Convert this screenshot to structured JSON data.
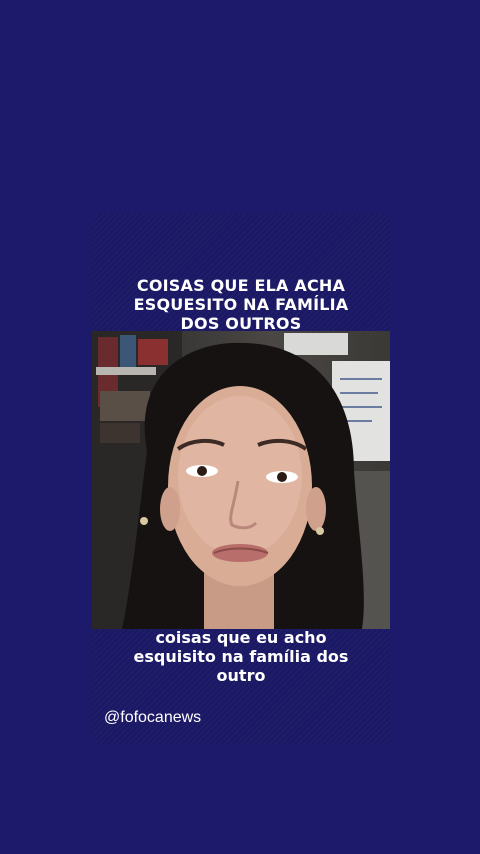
{
  "post": {
    "title_lines": [
      "COISAS QUE ELA ACHA",
      "ESQUESITO NA FAMÍLIA",
      "DOS OUTROS"
    ],
    "caption_lines": [
      "coisas que eu acho",
      "esquisito na família dos",
      "outro"
    ],
    "handle": "@fofocanews"
  },
  "colors": {
    "background": "#1d1a6c",
    "card": "#1b1865",
    "text": "#ffffff"
  }
}
